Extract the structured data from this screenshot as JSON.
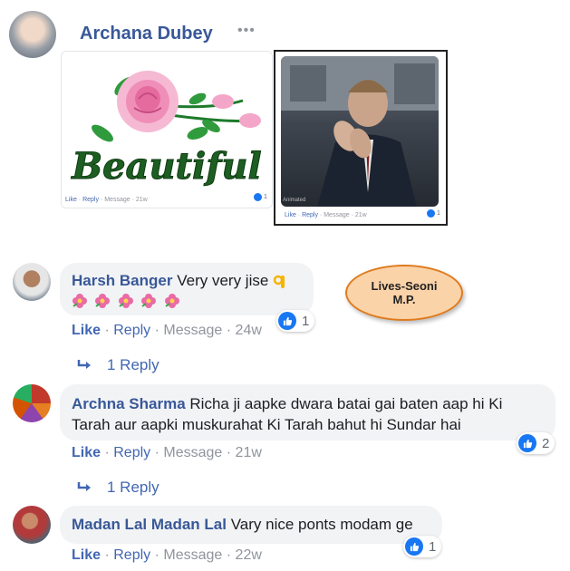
{
  "top_post": {
    "author": "Archana Dubey",
    "more_label": "•••",
    "image1_text": "Beautiful",
    "image1_meta": {
      "like": "Like",
      "reply": "Reply",
      "message": "Message",
      "time": "21w",
      "like_count": "1"
    },
    "image2_overlay": "Animated",
    "image2_meta": {
      "like": "Like",
      "reply": "Reply",
      "message": "Message",
      "time": "21w",
      "like_count": "1"
    }
  },
  "callout": {
    "line1": "Lives-Seoni",
    "line2": "M.P."
  },
  "comments": [
    {
      "author": "Harsh Banger",
      "text": "Very very jise",
      "actions": {
        "like": "Like",
        "reply": "Reply",
        "message": "Message",
        "time": "24w",
        "sep": "·"
      },
      "like_count": "1",
      "replies_label": "1 Reply"
    },
    {
      "author": "Archna Sharma",
      "text_line1": "Richa ji aapke dwara batai gai baten aap hi Ki",
      "text_line2": "Tarah aur aapki muskurahat Ki Tarah bahut hi Sundar hai",
      "actions": {
        "like": "Like",
        "reply": "Reply",
        "message": "Message",
        "time": "21w",
        "sep": "·"
      },
      "like_count": "2",
      "replies_label": "1 Reply"
    },
    {
      "author": "Madan Lal Madan Lal",
      "text": "Vary nice ponts modam ge",
      "actions": {
        "like": "Like",
        "reply": "Reply",
        "message": "Message",
        "time": "22w",
        "sep": "·"
      },
      "like_count": "1"
    }
  ],
  "colors": {
    "name": "#385898",
    "link": "#4267b2",
    "bubble": "#f2f3f5",
    "like_blue": "#1877f2",
    "callout_fill": "#fbd3a8",
    "callout_border": "#e07b1f"
  }
}
